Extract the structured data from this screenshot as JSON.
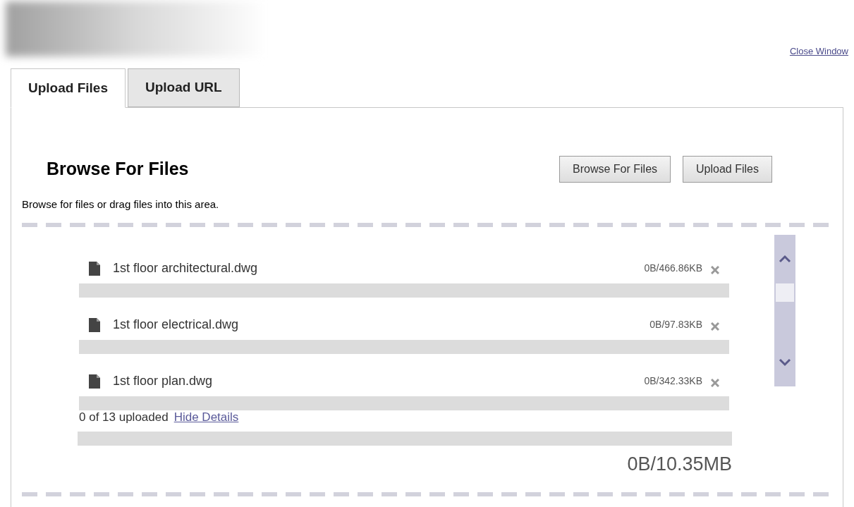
{
  "header": {
    "close_link": "Close Window"
  },
  "tabs": [
    {
      "label": "Upload Files",
      "selected": true
    },
    {
      "label": "Upload URL",
      "selected": false
    }
  ],
  "panel": {
    "title": "Browse For Files",
    "buttons": [
      "Browse For Files",
      "Upload Files"
    ],
    "hint": "Browse for files or drag files into this area.",
    "files": [
      {
        "name": "1st floor architectural.dwg",
        "size": "0B/466.86KB",
        "level": 0
      },
      {
        "name": "1st floor electrical.dwg",
        "size": "0B/97.83KB",
        "level": 0
      },
      {
        "name": "1st floor plan.dwg",
        "size": "0B/342.33KB",
        "level": 0
      }
    ],
    "summary": "0 of 13 uploaded",
    "details_link": "Hide Details",
    "total": {
      "level": 0
    },
    "total_size": "0B/10.35MB"
  }
}
